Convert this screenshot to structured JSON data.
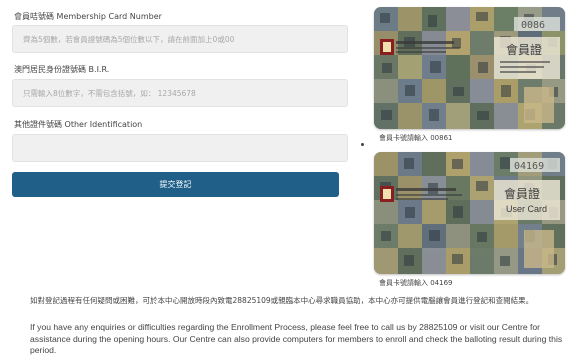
{
  "form": {
    "membership": {
      "label": "會員咭號碼 Membership Card Number",
      "placeholder": "齊為5個數，若會員證號碼為5個位數以下，請在前面加上0或00"
    },
    "bir": {
      "label": "澳門居民身份證號碼 B.I.R.",
      "placeholder": "只需輸入8位數字，不需包含括號，如： 12345678"
    },
    "other_id": {
      "label": "其他證件號碼 Other Identification",
      "placeholder": ""
    },
    "submit_label": "提交登記"
  },
  "cards": [
    {
      "number_display": "0086",
      "title": "會員證",
      "caption": "會員卡號請輸入 00861"
    },
    {
      "number_display": "04169",
      "title": "會員證",
      "subtitle": "User Card",
      "caption": "會員卡號請輸入 04169"
    }
  ],
  "notice": {
    "zh": "如對登記過程有任何疑問或困難，可於本中心開放時段內致電28825109或親臨本中心尋求職員協助，本中心亦可提供電腦讓會員進行登記和查閱結果。",
    "en": "If you have any enquiries or difficulties regarding the Enrollment Process, please feel free to call us by 28825109 or visit our Centre for assistance during the opening hours. Our Centre can also provide computers for members to enroll and check the balloting result during this period."
  },
  "colors": {
    "accent": "#1f5f88",
    "field_bg": "#f0f0f0"
  }
}
